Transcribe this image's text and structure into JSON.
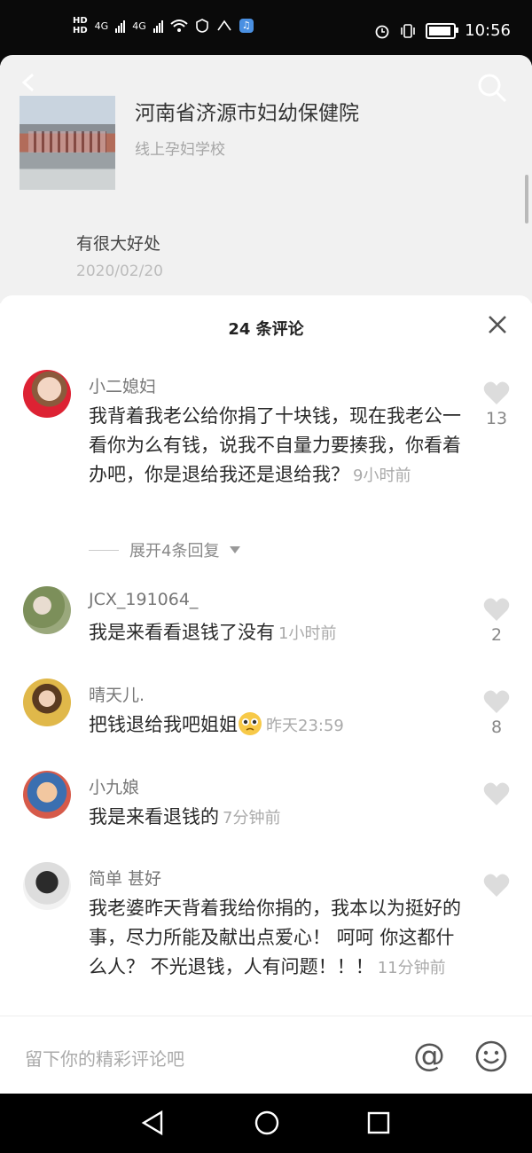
{
  "status_bar": {
    "hd1": "HD",
    "hd2": "HD",
    "net1": "4G",
    "net2": "4G",
    "time": "10:56"
  },
  "header": {
    "title": "河南省济源市妇幼保健院",
    "subtitle": "线上孕妇学校",
    "post_text": "有很大好处",
    "post_date": "2020/02/20"
  },
  "comments_sheet": {
    "title": "24 条评论",
    "comments": [
      {
        "name": "小二媳妇",
        "text": "我背着我老公给你捐了十块钱，现在我老公一看你为么有钱，说我不自量力要揍我，你看着办吧，你是退给我还是退给我？",
        "time": "9小时前",
        "likes": "13",
        "expand": "展开4条回复"
      },
      {
        "name": "JCX_191064_",
        "text": "我是来看看退钱了没有",
        "time": "1小时前",
        "likes": "2"
      },
      {
        "name": "晴天儿.",
        "text": "把钱退给我吧姐姐",
        "time": "昨天23:59",
        "likes": "8"
      },
      {
        "name": "小九娘",
        "text": "我是来看退钱的",
        "time": "7分钟前",
        "likes": ""
      },
      {
        "name": "简单 甚好",
        "text": "我老婆昨天背着我给你捐的，我本以为挺好的事，尽力所能及献出点爱心！ 呵呵 你这都什么人？ 不光退钱，人有问题！！！",
        "time": "11分钟前",
        "likes": ""
      }
    ]
  },
  "input_bar": {
    "placeholder": "留下你的精彩评论吧",
    "at_symbol": "@"
  },
  "icons": [
    "back-arrow-icon",
    "search-icon",
    "close-icon",
    "heart-icon",
    "caret-down-icon",
    "smile-icon",
    "nav-back-icon",
    "nav-home-icon",
    "nav-recent-icon"
  ],
  "colors": {
    "accent_text": "#2a2a2a",
    "muted": "#aaaaaa",
    "header_bg": "#f1f1f1"
  }
}
